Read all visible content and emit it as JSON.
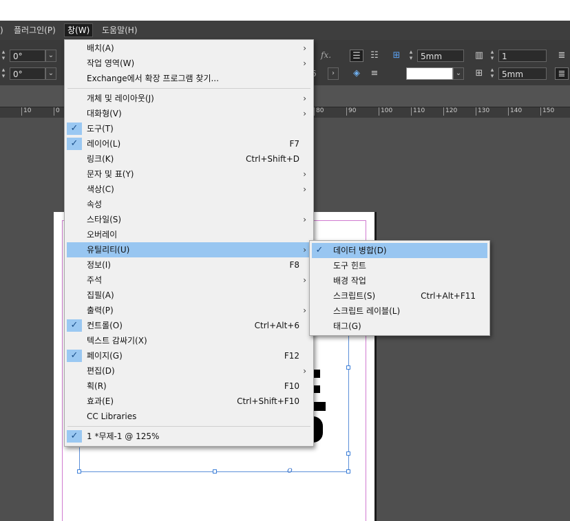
{
  "menubar": {
    "items": [
      {
        "label": ")"
      },
      {
        "label": "플러그인(P)"
      },
      {
        "label": "창(W)"
      },
      {
        "label": "도움말(H)"
      }
    ]
  },
  "control": {
    "angle1": "0°",
    "angle2": "0°",
    "fx": "fx.",
    "percent_tail": "6",
    "gutter1": "5mm",
    "columns": "1",
    "gutter2": "5mm"
  },
  "ruler": {
    "labels_left": [
      "10",
      "0"
    ],
    "labels_right": [
      "80",
      "90",
      "100",
      "110",
      "120",
      "130",
      "140",
      "150"
    ]
  },
  "window_menu": {
    "items": [
      {
        "label": "배치(A)",
        "shortcut": "",
        "submenu": true,
        "checked": false
      },
      {
        "label": "작업 영역(W)",
        "shortcut": "",
        "submenu": true,
        "checked": false
      },
      {
        "label": "Exchange에서 확장 프로그램 찾기...",
        "shortcut": "",
        "submenu": false,
        "checked": false
      },
      {
        "label": "개체 및 레이아웃(J)",
        "shortcut": "",
        "submenu": true,
        "checked": false
      },
      {
        "label": "대화형(V)",
        "shortcut": "",
        "submenu": true,
        "checked": false
      },
      {
        "label": "도구(T)",
        "shortcut": "",
        "submenu": false,
        "checked": true
      },
      {
        "label": "레이어(L)",
        "shortcut": "F7",
        "submenu": false,
        "checked": true
      },
      {
        "label": "링크(K)",
        "shortcut": "Ctrl+Shift+D",
        "submenu": false,
        "checked": false
      },
      {
        "label": "문자 및 표(Y)",
        "shortcut": "",
        "submenu": true,
        "checked": false
      },
      {
        "label": "색상(C)",
        "shortcut": "",
        "submenu": true,
        "checked": false
      },
      {
        "label": "속성",
        "shortcut": "",
        "submenu": false,
        "checked": false
      },
      {
        "label": "스타일(S)",
        "shortcut": "",
        "submenu": true,
        "checked": false
      },
      {
        "label": "오버레이",
        "shortcut": "",
        "submenu": false,
        "checked": false
      },
      {
        "label": "유틸리티(U)",
        "shortcut": "",
        "submenu": true,
        "checked": false,
        "highlighted": true
      },
      {
        "label": "정보(I)",
        "shortcut": "F8",
        "submenu": false,
        "checked": false
      },
      {
        "label": "주석",
        "shortcut": "",
        "submenu": true,
        "checked": false
      },
      {
        "label": "집필(A)",
        "shortcut": "",
        "submenu": false,
        "checked": false
      },
      {
        "label": "출력(P)",
        "shortcut": "",
        "submenu": true,
        "checked": false
      },
      {
        "label": "컨트롤(O)",
        "shortcut": "Ctrl+Alt+6",
        "submenu": false,
        "checked": true
      },
      {
        "label": "텍스트 감싸기(X)",
        "shortcut": "",
        "submenu": false,
        "checked": false
      },
      {
        "label": "페이지(G)",
        "shortcut": "F12",
        "submenu": false,
        "checked": true
      },
      {
        "label": "편집(D)",
        "shortcut": "",
        "submenu": true,
        "checked": false
      },
      {
        "label": "획(R)",
        "shortcut": "F10",
        "submenu": false,
        "checked": false
      },
      {
        "label": "효과(E)",
        "shortcut": "Ctrl+Shift+F10",
        "submenu": false,
        "checked": false
      },
      {
        "label": "CC Libraries",
        "shortcut": "",
        "submenu": false,
        "checked": false
      },
      {
        "label": "1 *무제-1 @ 125%",
        "shortcut": "",
        "submenu": false,
        "checked": true
      }
    ]
  },
  "utility_submenu": {
    "items": [
      {
        "label": "데이터 병합(D)",
        "shortcut": "",
        "checked": true,
        "highlighted": true
      },
      {
        "label": "도구 힌트",
        "shortcut": "",
        "checked": false
      },
      {
        "label": "배경 작업",
        "shortcut": "",
        "checked": false
      },
      {
        "label": "스크립트(S)",
        "shortcut": "Ctrl+Alt+F11",
        "checked": false
      },
      {
        "label": "스크립트 레이블(L)",
        "shortcut": "",
        "checked": false
      },
      {
        "label": "태그(G)",
        "shortcut": "",
        "checked": false
      }
    ]
  },
  "canvas": {
    "overset_marker": "o"
  },
  "icons": {
    "check": "✓",
    "submenu_arrow": "›",
    "dropdown": "⌄"
  },
  "colors": {
    "highlight": "#98c6f1",
    "menubar": "#3e3e3e",
    "pasteboard": "#4f4f4f",
    "frame": "#5b8fd8"
  }
}
